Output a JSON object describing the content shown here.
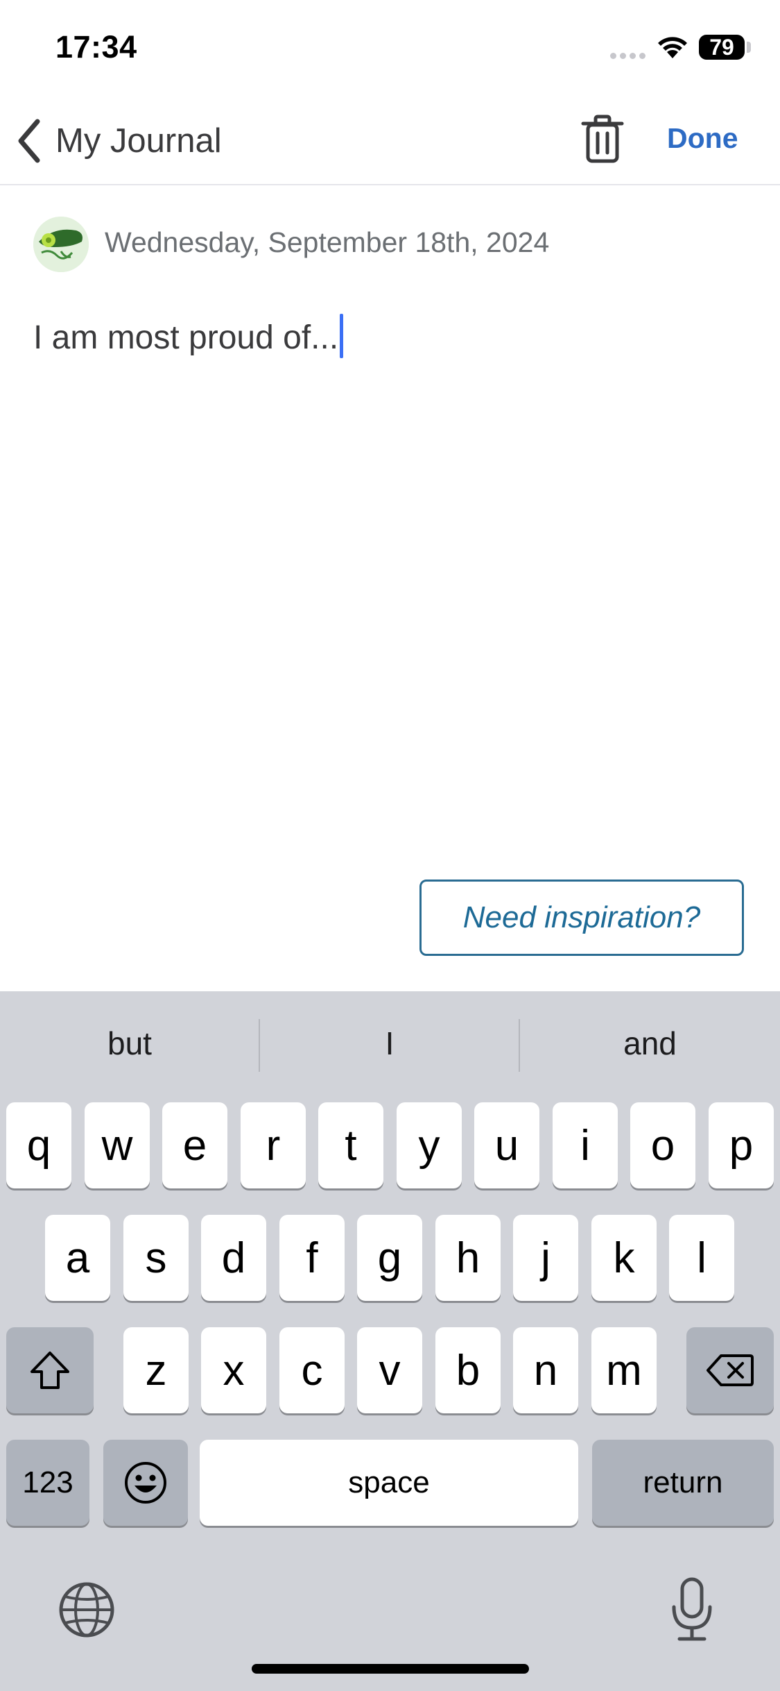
{
  "status_bar": {
    "time": "17:34",
    "battery": "79"
  },
  "nav": {
    "back_label": "My Journal",
    "done_label": "Done"
  },
  "entry": {
    "date": "Wednesday, September 18th, 2024",
    "text": "I am most proud of..."
  },
  "inspiration_button": "Need inspiration?",
  "keyboard": {
    "suggestions": [
      "but",
      "I",
      "and"
    ],
    "row1": [
      "q",
      "w",
      "e",
      "r",
      "t",
      "y",
      "u",
      "i",
      "o",
      "p"
    ],
    "row2": [
      "a",
      "s",
      "d",
      "f",
      "g",
      "h",
      "j",
      "k",
      "l"
    ],
    "row3": [
      "z",
      "x",
      "c",
      "v",
      "b",
      "n",
      "m"
    ],
    "numbers_label": "123",
    "space_label": "space",
    "return_label": "return"
  },
  "colors": {
    "accent": "#2d6bc4",
    "caret": "#3b6ff5",
    "inspire_border": "#2a6c92",
    "keyboard_bg": "#d1d3d9"
  }
}
